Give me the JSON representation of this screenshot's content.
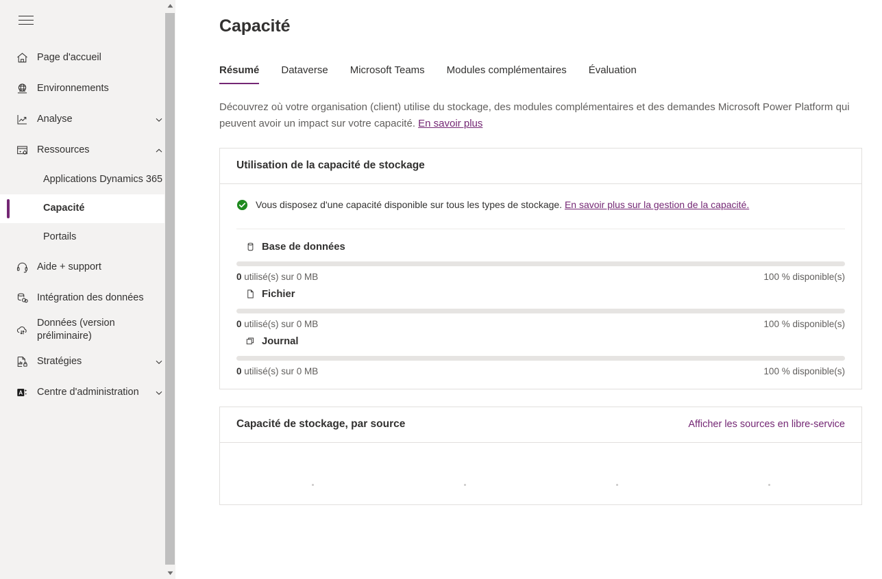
{
  "sidebar": {
    "menu_button": "menu-toggle",
    "items": [
      {
        "label": "Page d'accueil",
        "icon": "home-icon",
        "type": "item",
        "chevron": "none"
      },
      {
        "label": "Environnements",
        "icon": "globe-icon",
        "type": "item",
        "chevron": "none"
      },
      {
        "label": "Analyse",
        "icon": "analytics-icon",
        "type": "item",
        "chevron": "down"
      },
      {
        "label": "Ressources",
        "icon": "resources-icon",
        "type": "item",
        "chevron": "up"
      },
      {
        "label": "Applications Dynamics 365",
        "icon": "none",
        "type": "sub",
        "chevron": "none"
      },
      {
        "label": "Capacité",
        "icon": "none",
        "type": "sub",
        "chevron": "none",
        "selected": true
      },
      {
        "label": "Portails",
        "icon": "none",
        "type": "sub",
        "chevron": "none"
      },
      {
        "label": "Aide + support",
        "icon": "headset-icon",
        "type": "item",
        "chevron": "none"
      },
      {
        "label": "Intégration des données",
        "icon": "data-integration-icon",
        "type": "item",
        "chevron": "none"
      },
      {
        "label": "Données (version préliminaire)",
        "icon": "cloud-sync-icon",
        "type": "item",
        "chevron": "none"
      },
      {
        "label": "Stratégies",
        "icon": "policies-icon",
        "type": "item",
        "chevron": "down"
      },
      {
        "label": "Centre d'administration",
        "icon": "admin-center-icon",
        "type": "item",
        "chevron": "down"
      }
    ]
  },
  "main": {
    "title": "Capacité",
    "tabs": [
      {
        "label": "Résumé",
        "active": true
      },
      {
        "label": "Dataverse",
        "active": false
      },
      {
        "label": "Microsoft Teams",
        "active": false
      },
      {
        "label": "Modules complémentaires",
        "active": false
      },
      {
        "label": "Évaluation",
        "active": false
      }
    ],
    "intro": {
      "text": "Découvrez où votre organisation (client) utilise du stockage, des modules complémentaires et des demandes Microsoft Power Platform qui peuvent avoir un impact sur votre capacité. ",
      "link": "En savoir plus"
    },
    "storage_card": {
      "title": "Utilisation de la capacité de stockage",
      "status_icon": "success-check-icon",
      "status_text": "Vous disposez d'une capacité disponible sur tous les types de stockage. ",
      "status_link": "En savoir plus sur la gestion de la capacité.",
      "rows": [
        {
          "icon": "database-icon",
          "label": "Base de données",
          "used_value": "0",
          "used_text": " utilisé(s) sur 0 MB",
          "available": "100 % disponible(s)",
          "percent_used": 0
        },
        {
          "icon": "file-icon",
          "label": "Fichier",
          "used_value": "0",
          "used_text": " utilisé(s) sur 0 MB",
          "available": "100 % disponible(s)",
          "percent_used": 0
        },
        {
          "icon": "log-icon",
          "label": "Journal",
          "used_value": "0",
          "used_text": " utilisé(s) sur 0 MB",
          "available": "100 % disponible(s)",
          "percent_used": 0
        }
      ]
    },
    "source_card": {
      "title": "Capacité de stockage, par source",
      "action": "Afficher les sources en libre-service"
    }
  },
  "colors": {
    "accent": "#742774",
    "success": "#107c10",
    "sidebar_bg": "#f3f2f1",
    "track": "#e6e4e2",
    "border": "#e1dfdd"
  }
}
